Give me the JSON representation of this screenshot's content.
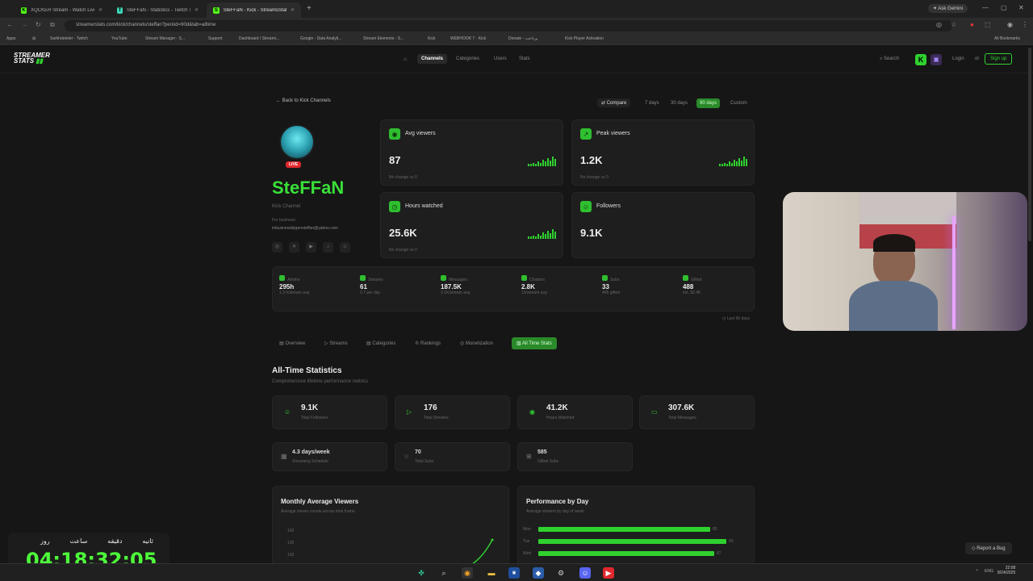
{
  "browser": {
    "tabs": [
      {
        "title": "XQCKER Stream - Watch Live on",
        "icon": "K",
        "icon_color": "#53fc18"
      },
      {
        "title": "SteFFaN - Statistics - Twitch Track",
        "icon": "T",
        "icon_color": "#3bd6b6"
      },
      {
        "title": "SteFFaN - Kick - StreamsStats",
        "icon": "S",
        "icon_color": "#53fc18"
      }
    ],
    "new_tab": "+",
    "ask_gemini": "Ask Gemini",
    "url": "streamerstats.com/kick/channels/steffan?period=90d&tab=alltime",
    "bookmarks": [
      "Apps",
      "Sarkhdeteler - Twitch",
      "YouTube",
      "Stream Manager - S...",
      "Support",
      "Dashboard / Streami...",
      "Google - Data Analyti...",
      "Stream Elements - S...",
      "Kick",
      "WEBHOOK 7 - Kick",
      "Donate - پرداخت",
      "Kick Player Activation"
    ],
    "all_bookmarks": "All Bookmarks"
  },
  "site": {
    "logo_line1": "STREAMER",
    "logo_line2": "STATS",
    "nav": [
      "Channels",
      "Categories",
      "Users",
      "Stats"
    ],
    "search": "Search",
    "login": "Login",
    "or": "or",
    "signup": "Sign up"
  },
  "channel": {
    "back": "Back to Kick Channels",
    "compare": "Compare",
    "periods": [
      "7 days",
      "30 days",
      "90 days",
      "Custom"
    ],
    "live_badge": "LIVE",
    "name": "SteFFaN",
    "platform": "Kick Channel",
    "bio_line1": "For business:",
    "bio_line2": "inbusinesskippersteffan@yahoo.com"
  },
  "kpis": [
    {
      "label": "Avg viewers",
      "value": "87",
      "note": "No change vs 0"
    },
    {
      "label": "Peak viewers",
      "value": "1.2K",
      "note": "No change vs 0"
    },
    {
      "label": "Hours watched",
      "value": "25.6K",
      "note": "No change vs 0"
    },
    {
      "label": "Followers",
      "value": "9.1K",
      "note": ""
    }
  ],
  "mini_stats": [
    {
      "label": "Airtime",
      "value": "295h",
      "sub": "1.3 h/stream avg"
    },
    {
      "label": "Streams",
      "value": "61",
      "sub": "0.7 per day"
    },
    {
      "label": "Messages",
      "value": "187.5K",
      "sub": "3.1K/stream avg"
    },
    {
      "label": "Chatters",
      "value": "2.8K",
      "sub": "13/stream avg"
    },
    {
      "label": "Subs",
      "value": "33",
      "sub": "406 gifted"
    },
    {
      "label": "Gifted",
      "value": "488",
      "sub": "est. $2.4K"
    }
  ],
  "last_note": "Last 90 days",
  "subtabs": [
    "Overview",
    "Streams",
    "Categories",
    "Rankings",
    "Monetization",
    "All Time Stats"
  ],
  "alltime": {
    "title": "All-Time Statistics",
    "subtitle": "Comprehensive lifetime performance metrics",
    "cards": [
      {
        "value": "9.1K",
        "label": "Total Followers"
      },
      {
        "value": "176",
        "label": "Total Streams"
      },
      {
        "value": "41.2K",
        "label": "Hours Watched"
      },
      {
        "value": "307.6K",
        "label": "Total Messages"
      }
    ],
    "small_cards": [
      {
        "value": "4.3 days/week",
        "label": "Streaming Schedule"
      },
      {
        "value": "70",
        "label": "Total Subs"
      },
      {
        "value": "585",
        "label": "Gifted Subs"
      }
    ]
  },
  "monthly": {
    "title": "Monthly Average Viewers",
    "subtitle": "Average viewer counts across time frame",
    "y_ticks": [
      "100",
      "100",
      "100"
    ]
  },
  "perf": {
    "title": "Performance by Day",
    "subtitle": "Average viewers by day of week",
    "days": [
      {
        "day": "Mon",
        "value": 85,
        "label": "85"
      },
      {
        "day": "Tue",
        "value": 93,
        "label": "93"
      },
      {
        "day": "Wed",
        "value": 87,
        "label": "87"
      }
    ]
  },
  "report_bug": "Report a Bug",
  "timer": {
    "labels": [
      "روز",
      "ساعت",
      "دقیقه",
      "ثانیه"
    ],
    "value": "04:18:32:05"
  },
  "clock": {
    "time": "22:08",
    "date": "8/24/2025",
    "lang": "ENG"
  }
}
